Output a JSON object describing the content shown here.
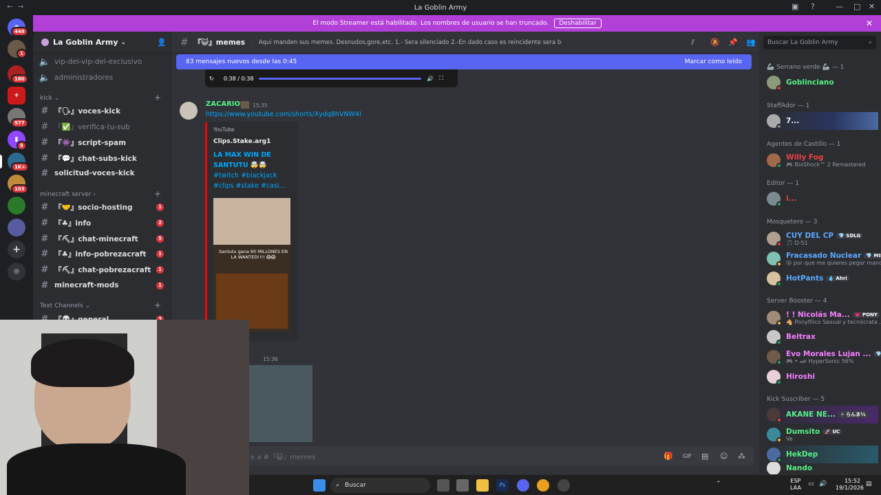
{
  "window": {
    "title": "La Goblin Army"
  },
  "banner": {
    "text": "El modo Streamer está habilitado. Los nombres de usuario se han truncado.",
    "button": "Deshabilitar"
  },
  "servers": {
    "badges": [
      "448",
      "1",
      "180",
      "",
      "977",
      "5",
      "",
      "1K+",
      "103"
    ]
  },
  "guild": {
    "name": "La Goblin Army"
  },
  "channels": [
    {
      "name": "vip-del-vip-del-exclusivo",
      "muted": true
    },
    {
      "name": "administradores",
      "muted": true
    },
    {
      "cat": "kick"
    },
    {
      "name": "『🗣』voces-kick"
    },
    {
      "name": "『✅』verifica-tu-sub",
      "muted": true
    },
    {
      "name": "『👾』script-spam"
    },
    {
      "name": "『💬』chat-subs-kick"
    },
    {
      "name": "solicitud-voces-kick"
    },
    {
      "cat": "minecraft server"
    },
    {
      "name": "『🤝』socio-hosting",
      "count": "1"
    },
    {
      "name": "『♣』info",
      "count": "2"
    },
    {
      "name": "『⛏』chat-minecraft",
      "count": "5"
    },
    {
      "name": "『♣』info-pobrezacraft",
      "count": "1"
    },
    {
      "name": "『⛏』chat-pobrezacraft",
      "count": "1"
    },
    {
      "name": "minecraft-mods",
      "count": "1"
    },
    {
      "cat": "Text Channels"
    },
    {
      "name": "『💀』general",
      "count": "3"
    }
  ],
  "channel": {
    "name": "『😺』memes",
    "topic": "Aqui manden sus memes. Desnudos,gore,etc. 1.- Sera silenciado 2.-En dado caso es reincidente sera baneado"
  },
  "newbar": {
    "text": "83 mensajes nuevos desde las 0:45",
    "action": "Marcar como leído"
  },
  "player": {
    "time": "0:38 / 0:38"
  },
  "message": {
    "author": "ZACARIOS",
    "time": "15:35",
    "link": "https://www.youtube.com/shorts/Xydq8hVNW4I",
    "embed": {
      "provider": "YouTube",
      "author": "Clips.Stake.arg1",
      "title1": "LA MAX WIN DE",
      "title2": "SANTUTU 🤯🤯",
      "desc1": "#twitch #blackjack",
      "desc2": "#clips #stake #casi...",
      "thumb": "Santutu gana 90 MILLONES EN LA WANTED!!!! 😱😱"
    }
  },
  "message2": {
    "time": "15:36"
  },
  "composer": {
    "placeholder": "Envía un mensaje a #『😺』memes",
    "visible": "e a #『😺』memes"
  },
  "search": {
    "placeholder": "Buscar La Goblin Army"
  },
  "members": [
    {
      "cat": "🦾 Serrano verde 🦾 — 1"
    },
    {
      "name": "Goblinciano",
      "color": "#57f287"
    },
    {
      "cat": "StaffAdor — 1"
    },
    {
      "name": "7...",
      "color": "#f2f3f5"
    },
    {
      "cat": "Agentes de Castillo — 1"
    },
    {
      "name": "Willy Fog",
      "color": "#ed4245",
      "sub": "🎮 BioShock™ 2 Remastered"
    },
    {
      "cat": "Editor — 1"
    },
    {
      "name": "i...",
      "color": "#ed4245"
    },
    {
      "cat": "Mosquetero — 3"
    },
    {
      "name": "CUY DEL CP",
      "color": "#5ca8ff",
      "tag": "💎 SDLG",
      "sub": "🎵 D-51"
    },
    {
      "name": "Fracasado Nuclear",
      "color": "#5ca8ff",
      "tag": "💎 MIKU",
      "sub": "😮 por que me quieres pegar mano?"
    },
    {
      "name": "HotPants",
      "color": "#5ca8ff",
      "tag": "💧 Ahri"
    },
    {
      "cat": "Server Booster — 4"
    },
    {
      "name": "! ! Nicolás Ma...",
      "color": "#f47fff",
      "tag": "💗 PONY",
      "sub": "🐴 Ponyfílico Sexual y tecnócrata ..."
    },
    {
      "name": "Beltrax",
      "color": "#f47fff"
    },
    {
      "name": "Evo Morales Lujan ...",
      "color": "#f47fff",
      "tag": "💎 GD",
      "sub": "🎮 • 🏎 HyperSonic 56%"
    },
    {
      "name": "Hiroshi",
      "color": "#f47fff"
    },
    {
      "cat": "Kick Suscriber — 5"
    },
    {
      "name": "AKANE NE...",
      "color": "#57f287",
      "tag": "✧ らんま½"
    },
    {
      "name": "Dumsito",
      "color": "#57f287",
      "tag": "🚀 UC",
      "sub": "Ve"
    },
    {
      "name": "HekDep",
      "color": "#57f287"
    },
    {
      "name": "Nando",
      "color": "#57f287"
    }
  ],
  "taskbar": {
    "search": "Buscar",
    "lang1": "ESP",
    "lang2": "LAA",
    "time": "15:52",
    "date": "19/1/2026"
  }
}
